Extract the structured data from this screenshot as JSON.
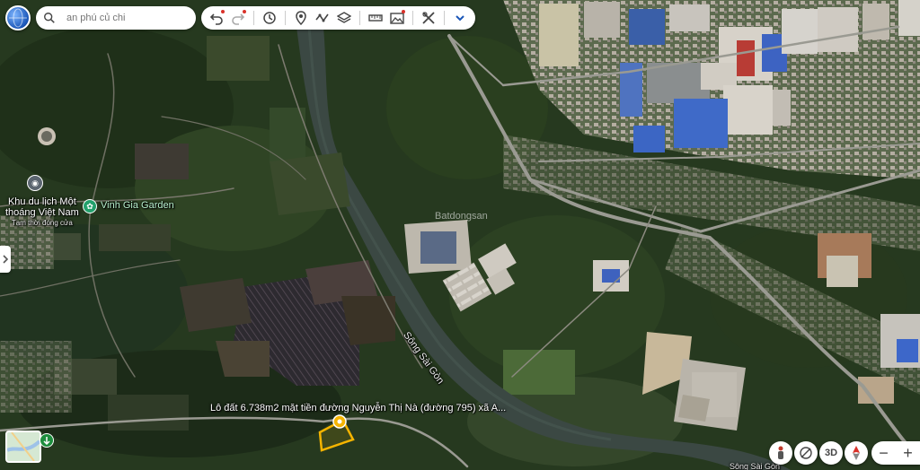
{
  "search": {
    "value": "",
    "placeholder": "an phú củ chi"
  },
  "toolbar": {
    "icons": [
      "undo-icon",
      "redo-icon",
      "history-icon",
      "placemark-icon",
      "path-icon",
      "layers-icon",
      "ruler-icon",
      "image-icon",
      "tools-icon",
      "chevron-down-icon"
    ]
  },
  "places": {
    "park_name_line1": "Khu du lịch Một",
    "park_name_line2": "thoáng Việt Nam",
    "park_status": "Tạm thời đóng cửa",
    "garden_name": "Vinh Gia Garden",
    "river_name": "Sông Sài Gòn",
    "river_name_lower": "Sông Sài Gòn"
  },
  "plot_label": "Lô đất 6.738m2 mặt tiền đường Nguyễn Thị Nà (đường 795) xã A...",
  "watermark": "Batdongsan",
  "controls": {
    "view3d": "3D",
    "zoom_out": "−",
    "zoom_in": "+"
  },
  "colors": {
    "plot_outline": "#f5b400",
    "river": "#3c4a44",
    "road": "#9a9a92"
  }
}
